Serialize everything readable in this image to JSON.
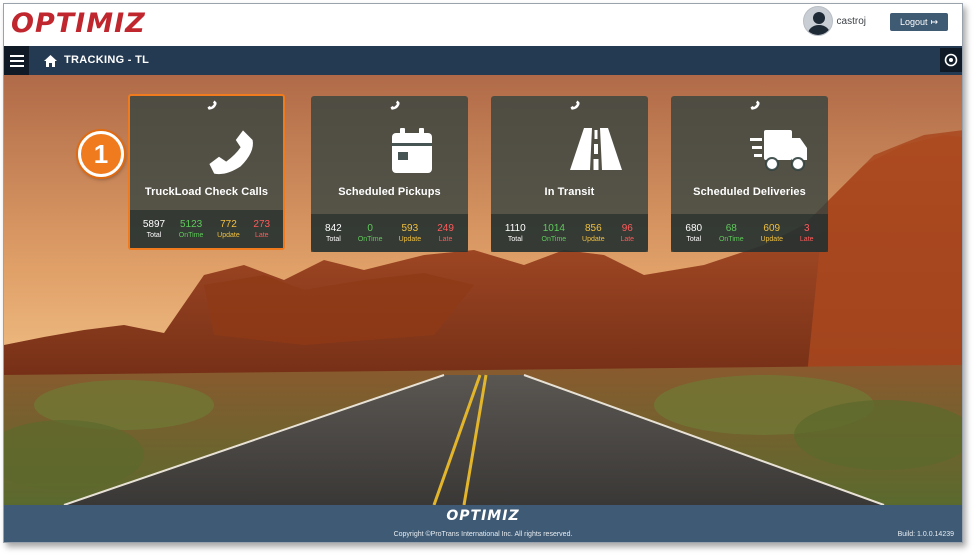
{
  "app": {
    "logo_text": "OPTIMIZ"
  },
  "user": {
    "name": "castroj",
    "logout_label": "Logout"
  },
  "nav": {
    "title": "TRACKING - TL"
  },
  "step_badge": "1",
  "cards": [
    {
      "title": "TruckLoad Check Calls",
      "icon": "phone-icon",
      "total": "5897",
      "ontime": "5123",
      "update": "772",
      "late": "273"
    },
    {
      "title": "Scheduled Pickups",
      "icon": "calendar-icon",
      "total": "842",
      "ontime": "0",
      "update": "593",
      "late": "249"
    },
    {
      "title": "In Transit",
      "icon": "road-icon",
      "total": "1110",
      "ontime": "1014",
      "update": "856",
      "late": "96"
    },
    {
      "title": "Scheduled Deliveries",
      "icon": "truck-icon",
      "total": "680",
      "ontime": "68",
      "update": "609",
      "late": "3"
    }
  ],
  "labels": {
    "total": "Total",
    "ontime": "OnTime",
    "update": "Update",
    "late": "Late"
  },
  "footer": {
    "logo_text": "OPTIMIZ",
    "copyright": "Copyright ©ProTrans International Inc. All rights reserved.",
    "build": "Build: 1.0.0.14239"
  },
  "colors": {
    "accent": "#f07b1e",
    "nav": "#243a53",
    "footer": "#3e5a74",
    "logo": "#c0262d"
  }
}
